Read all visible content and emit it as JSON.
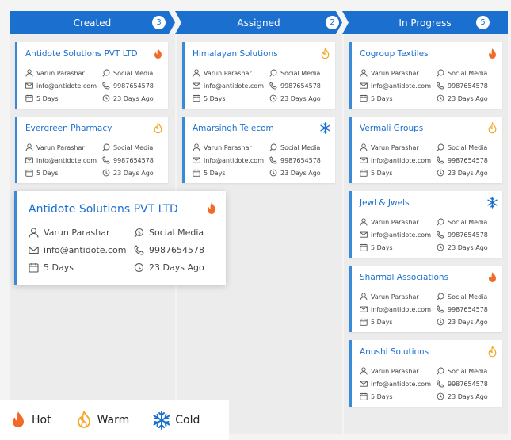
{
  "columns": [
    {
      "title": "Created",
      "count": "3",
      "cards": [
        {
          "name": "Antidote Solutions PVT LTD",
          "person": "Varun Parashar",
          "source": "Social Media",
          "email": "info@antidote.com",
          "phone": "9987654578",
          "duration": "5 Days",
          "ago": "23 Days Ago",
          "temp": "hot"
        },
        {
          "name": "Evergreen Pharmacy",
          "person": "Varun Parashar",
          "source": "Social Media",
          "email": "info@antidote.com",
          "phone": "9987654578",
          "duration": "5 Days",
          "ago": "23 Days Ago",
          "temp": "warm"
        }
      ]
    },
    {
      "title": "Assigned",
      "count": "2",
      "cards": [
        {
          "name": "Himalayan Solutions",
          "person": "Varun Parashar",
          "source": "Social Media",
          "email": "info@antidote.com",
          "phone": "9987654578",
          "duration": "5 Days",
          "ago": "23 Days Ago",
          "temp": "warm"
        },
        {
          "name": "Amarsingh Telecom",
          "person": "Varun Parashar",
          "source": "Social Media",
          "email": "info@antidote.com",
          "phone": "9987654578",
          "duration": "5 Days",
          "ago": "23 Days Ago",
          "temp": "cold"
        }
      ]
    },
    {
      "title": "In Progress",
      "count": "5",
      "cards": [
        {
          "name": "Cogroup Textiles",
          "person": "Varun Parashar",
          "source": "Social Media",
          "email": "info@antidote.com",
          "phone": "9987654578",
          "duration": "5 Days",
          "ago": "23 Days Ago",
          "temp": "hot"
        },
        {
          "name": "Vermali Groups",
          "person": "Varun Parashar",
          "source": "Social Media",
          "email": "info@antidote.com",
          "phone": "9987654578",
          "duration": "5 Days",
          "ago": "23 Days Ago",
          "temp": "warm"
        },
        {
          "name": "Jewl & Jwels",
          "person": "Varun Parashar",
          "source": "Social Media",
          "email": "info@antidote.com",
          "phone": "9987654578",
          "duration": "5 Days",
          "ago": "23 Days Ago",
          "temp": "cold"
        },
        {
          "name": "Sharmal Associations",
          "person": "Varun Parashar",
          "source": "Social Media",
          "email": "info@antidote.com",
          "phone": "9987654578",
          "duration": "5 Days",
          "ago": "23 Days Ago",
          "temp": "hot"
        },
        {
          "name": "Anushi Solutions",
          "person": "Varun Parashar",
          "source": "Social Media",
          "email": "info@antidote.com",
          "phone": "9987654578",
          "duration": "5 Days",
          "ago": "23 Days Ago",
          "temp": "warm"
        }
      ]
    }
  ],
  "dragging": {
    "name": "Antidote Solutions PVT LTD",
    "person": "Varun Parashar",
    "source": "Social Media",
    "email": "info@antidote.com",
    "phone": "9987654578",
    "duration": "5 Days",
    "ago": "23 Days Ago",
    "temp": "hot"
  },
  "legend": {
    "hot": "Hot",
    "warm": "Warm",
    "cold": "Cold"
  },
  "colors": {
    "accent": "#1a6fcf",
    "hot": "#f26a2a",
    "warm": "#f5a623",
    "cold": "#1a6fcf"
  },
  "icons": {
    "hot": "flame-filled-icon",
    "warm": "flame-outline-icon",
    "cold": "snowflake-icon",
    "person": "person-icon",
    "source": "source-icon",
    "email": "email-icon",
    "phone": "phone-icon",
    "duration": "calendar-icon",
    "ago": "history-icon"
  }
}
